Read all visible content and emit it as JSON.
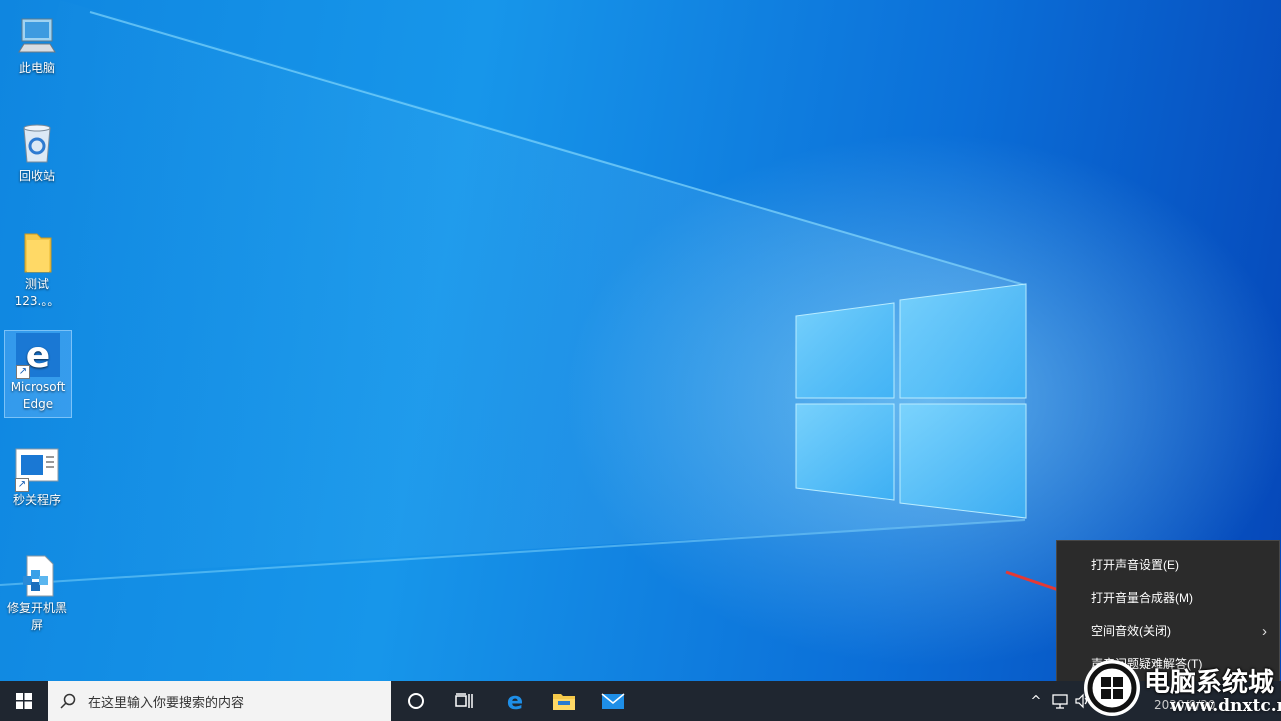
{
  "desktop": {
    "icons": [
      {
        "label": "此电脑",
        "icon": "this-pc-icon"
      },
      {
        "label": "回收站",
        "icon": "recycle-bin-icon"
      },
      {
        "label": "测试123.。。",
        "icon": "folder-icon"
      },
      {
        "label": "Microsoft Edge",
        "icon": "edge-icon"
      },
      {
        "label": "秒关程序",
        "icon": "app-window-icon"
      },
      {
        "label": "修复开机黑屏",
        "icon": "repair-tool-icon"
      }
    ]
  },
  "context_menu": {
    "items": [
      {
        "label": "打开声音设置(E)"
      },
      {
        "label": "打开音量合成器(M)"
      },
      {
        "label": "空间音效(关闭)"
      },
      {
        "label": "声音问题疑难解答(T)"
      }
    ]
  },
  "taskbar": {
    "search_placeholder": "在这里输入你要搜索的内容",
    "date": "2020/9/20"
  },
  "watermark": {
    "text": "电脑系统城",
    "url": "www.dnxtc.net"
  },
  "colors": {
    "accent": "#0a74d6",
    "taskbar": "#1f2630",
    "menu": "#2b2b2b",
    "arrow": "#e53935"
  }
}
